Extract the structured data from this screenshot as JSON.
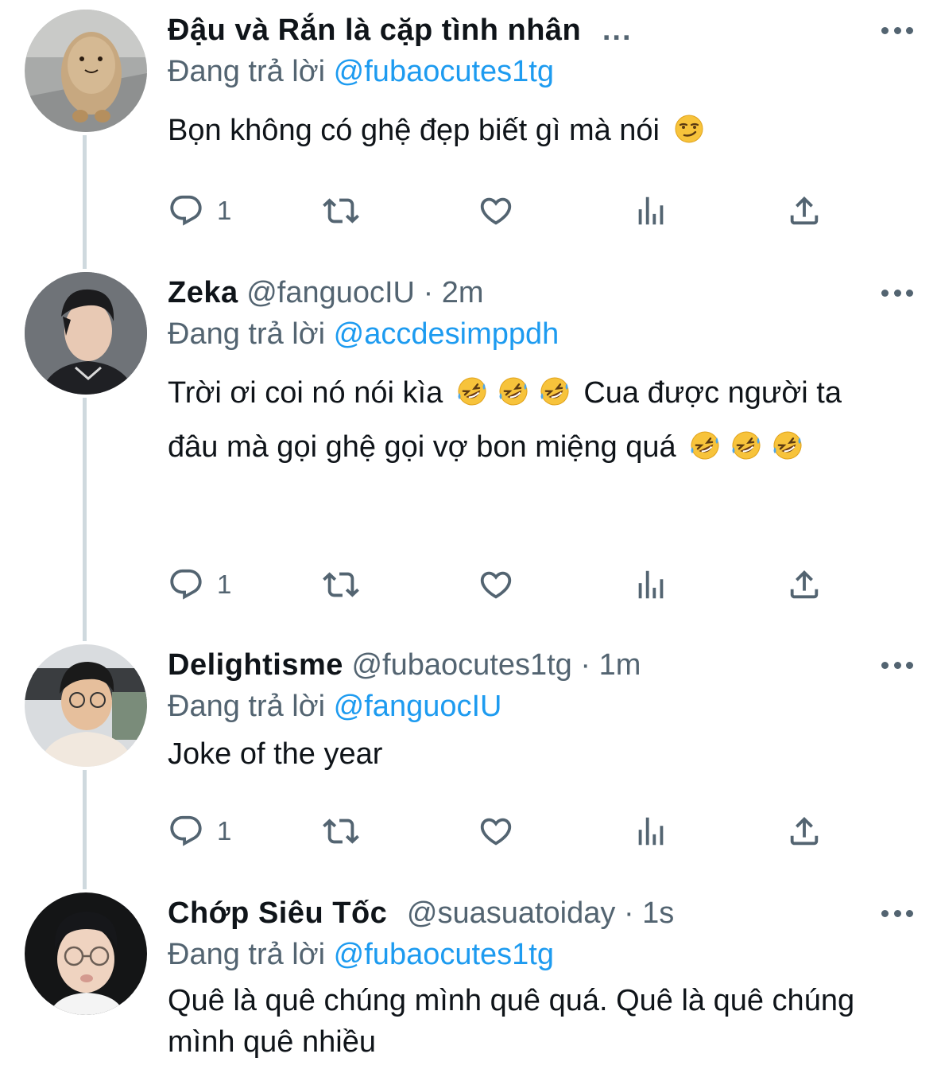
{
  "tweets": [
    {
      "display_name": "Đậu và Rắn là cặp tình nhân",
      "name_ellipsis": "...",
      "handle": "",
      "time": "",
      "reply_prefix": "Đang trả lời",
      "reply_to": "@fubaocutes1tg",
      "text_1": "Bọn không có ghệ đẹp biết gì mà nói",
      "text_2": "",
      "reply_count": "1"
    },
    {
      "display_name": "Zeka",
      "handle": "@fanguocIU",
      "separator": "·",
      "time": "2m",
      "reply_prefix": "Đang trả lời",
      "reply_to": "@accdesimppdh",
      "text_1": "Trời ơi coi nó nói kìa",
      "text_2": "Cua được người ta đâu mà gọi ghệ gọi vợ bon miệng quá",
      "reply_count": "1"
    },
    {
      "display_name": "Delightisme",
      "handle": "@fubaocutes1tg",
      "separator": "·",
      "time": "1m",
      "reply_prefix": "Đang trả lời",
      "reply_to": "@fanguocIU",
      "text_1": "Joke of the year",
      "reply_count": "1"
    },
    {
      "display_name": "Chớp Siêu Tốc",
      "handle": "@suasuatoiday",
      "separator": "·",
      "time": "1s",
      "reply_prefix": "Đang trả lời",
      "reply_to": "@fubaocutes1tg",
      "text_1": "Quê là quê chúng mình quê quá. Quê là quê chúng mình quê nhiều"
    }
  ],
  "icons": {
    "reply": "reply-icon",
    "retweet": "retweet-icon",
    "like": "heart-icon",
    "views": "views-icon",
    "share": "share-icon",
    "more": "more-icon",
    "smirk_emoji": "smirk-emoji-icon",
    "rofl_emoji": "rofl-emoji-icon"
  },
  "colors": {
    "text": "#0f1419",
    "secondary": "#536471",
    "link": "#1d9bf0",
    "thread_line": "#cfd9de"
  }
}
